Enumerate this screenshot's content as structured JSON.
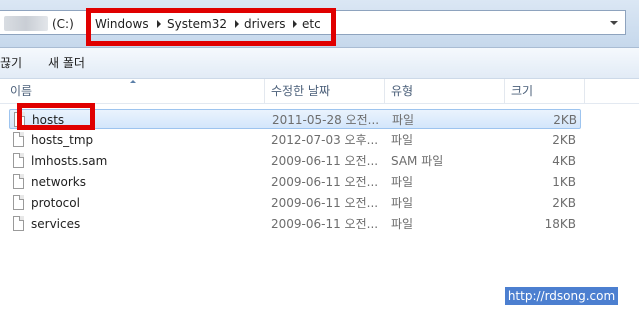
{
  "address_bar": {
    "drive": "(C:)",
    "crumbs": [
      "Windows",
      "System32",
      "drivers",
      "etc"
    ]
  },
  "toolbar": {
    "partial_label": "끊기",
    "new_folder_label": "새 폴더"
  },
  "columns": {
    "name": "이름",
    "date": "수정한 날짜",
    "type": "유형",
    "size": "크기"
  },
  "files": [
    {
      "name": "hosts",
      "date": "2011-05-28 오전...",
      "type": "파일",
      "size": "2KB",
      "selected": true
    },
    {
      "name": "hosts_tmp",
      "date": "2012-07-03 오후...",
      "type": "파일",
      "size": "2KB"
    },
    {
      "name": "lmhosts.sam",
      "date": "2009-06-11 오전...",
      "type": "SAM 파일",
      "size": "4KB"
    },
    {
      "name": "networks",
      "date": "2009-06-11 오전...",
      "type": "파일",
      "size": "1KB"
    },
    {
      "name": "protocol",
      "date": "2009-06-11 오전...",
      "type": "파일",
      "size": "2KB"
    },
    {
      "name": "services",
      "date": "2009-06-11 오전...",
      "type": "파일",
      "size": "18KB"
    }
  ],
  "watermark": "http://rdsong.com",
  "colors": {
    "annotation": "#e00000",
    "selection": "#d3e6fb",
    "watermark_bg": "#4c7fd0"
  }
}
